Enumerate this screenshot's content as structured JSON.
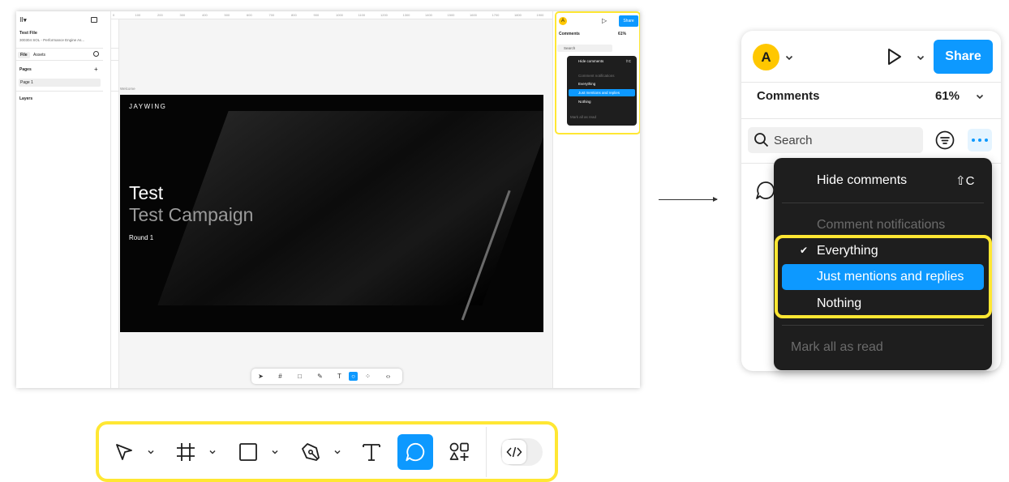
{
  "screenshot": {
    "file": {
      "name": "Test File",
      "subtitle": "300304 SOL - Performance Engine As..."
    },
    "tabs": [
      "File",
      "Assets"
    ],
    "pages_label": "Pages",
    "page_item": "Page 1",
    "layers_label": "Layers",
    "ruler_ticks": [
      "0",
      "100",
      "200",
      "300",
      "400",
      "500",
      "600",
      "700",
      "800",
      "900",
      "1000",
      "1100",
      "1200",
      "1300",
      "1400",
      "1500",
      "1600",
      "1700",
      "1800",
      "1900"
    ],
    "frame_label": "Welcome",
    "frame": {
      "brand": "JAYWING",
      "title": "Test",
      "subtitle": "Test Campaign",
      "round": "Round 1"
    },
    "help": "?",
    "mini_panel": {
      "avatar": "A",
      "share": "Share",
      "comments": "Comments",
      "zoom": "61%",
      "search": "Search",
      "menu": [
        "Hide comments",
        "Comment notifications",
        "Everything",
        "Just mentions and replies",
        "Nothing",
        "Mark all as read"
      ],
      "shortcut": "⇧C"
    }
  },
  "zoom_panel": {
    "avatar": "A",
    "share_label": "Share",
    "comments_title": "Comments",
    "zoom": "61%",
    "search_placeholder": "Search"
  },
  "dropdown": {
    "hide_comments": "Hide comments",
    "hide_shortcut": "⇧C",
    "header": "Comment notifications",
    "everything": "Everything",
    "just_mentions": "Just mentions and replies",
    "nothing": "Nothing",
    "mark_all_read": "Mark all as read"
  },
  "toolbar": {
    "tools": [
      "move-tool",
      "frame-tool",
      "shape-tool",
      "pen-tool",
      "text-tool",
      "comment-tool",
      "actions-tool"
    ],
    "selected": "comment-tool",
    "dev_mode": "dev-mode-toggle"
  },
  "colors": {
    "accent": "#0d99ff",
    "highlight": "#ffe733",
    "menu_bg": "#1e1e1e",
    "avatar": "#ffc700"
  }
}
